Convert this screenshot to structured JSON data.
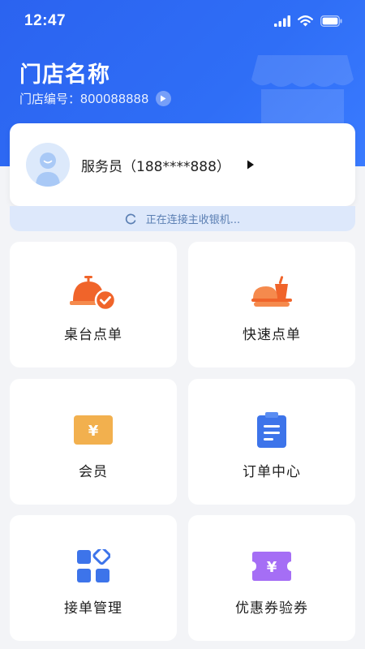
{
  "status_bar": {
    "time": "12:47",
    "icons": [
      "signal-icon",
      "wifi-icon",
      "battery-icon"
    ]
  },
  "store": {
    "name": "门店名称",
    "number_label": "门店编号：",
    "number_value": "800088888"
  },
  "user": {
    "name": "服务员（188****888）"
  },
  "connection": {
    "status_text": "正在连接主收银机..."
  },
  "menu": {
    "items": [
      {
        "label": "桌台点单",
        "icon": "cloche-check-icon"
      },
      {
        "label": "快速点单",
        "icon": "fast-food-icon"
      },
      {
        "label": "会员",
        "icon": "member-card-icon"
      },
      {
        "label": "订单中心",
        "icon": "clipboard-icon"
      },
      {
        "label": "接单管理",
        "icon": "apps-grid-icon"
      },
      {
        "label": "优惠券验券",
        "icon": "coupon-icon"
      }
    ]
  },
  "colors": {
    "header_blue": "#2f6ef6",
    "accent_orange": "#f0642a",
    "accent_blue": "#3d74ea",
    "accent_purple": "#a56ef5",
    "accent_gold": "#f2b04e"
  }
}
